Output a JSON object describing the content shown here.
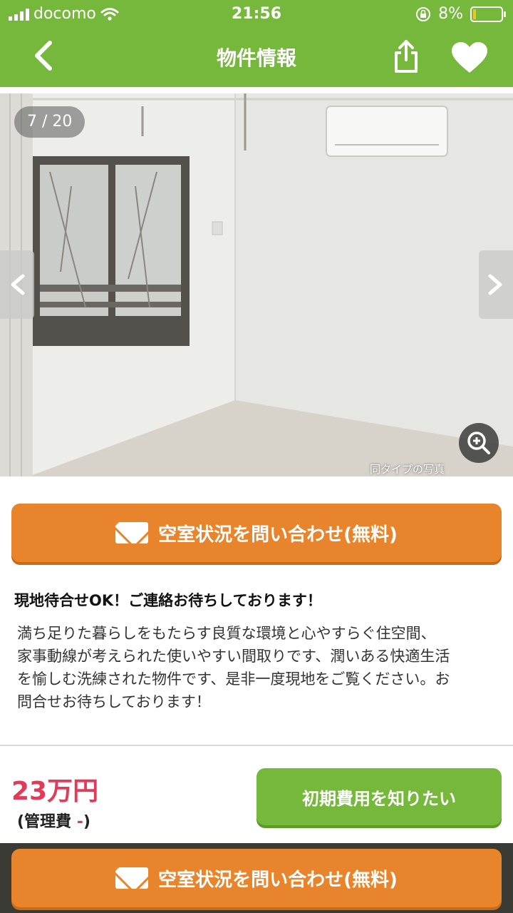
{
  "status_bar": {
    "carrier": "docomo",
    "time": "21:56",
    "battery": "8%"
  },
  "nav": {
    "title": "物件情報"
  },
  "photo": {
    "counter": "7 / 20",
    "caption": "同タイプの写真"
  },
  "inquiry_button": {
    "label": "空室状況を問い合わせ(無料)"
  },
  "description": {
    "title": "現地待合せOK！ご連絡お待ちしております！",
    "lines": [
      "満ち足りた暮らしをもたらす良質な環境と心やすらぐ住空間、",
      "家事動線が考えられた使いやすい間取りです、潤いある快適生活",
      "を愉しむ洗練された物件です、是非一度現地をご覧ください。お",
      "問合せお待ちしております！"
    ]
  },
  "price": {
    "rent": "23万円",
    "mgmt_prefix": "(管理費 ",
    "mgmt_value": "-",
    "mgmt_suffix": ")"
  },
  "initial_cost_button": {
    "label": "初期費用を知りたい"
  },
  "bottom_bar": {
    "label": "空室状況を問い合わせ(無料)"
  },
  "colors": {
    "brand_green": "#76b83c",
    "cta_orange": "#e8842b",
    "price_red": "#e23b5a"
  }
}
